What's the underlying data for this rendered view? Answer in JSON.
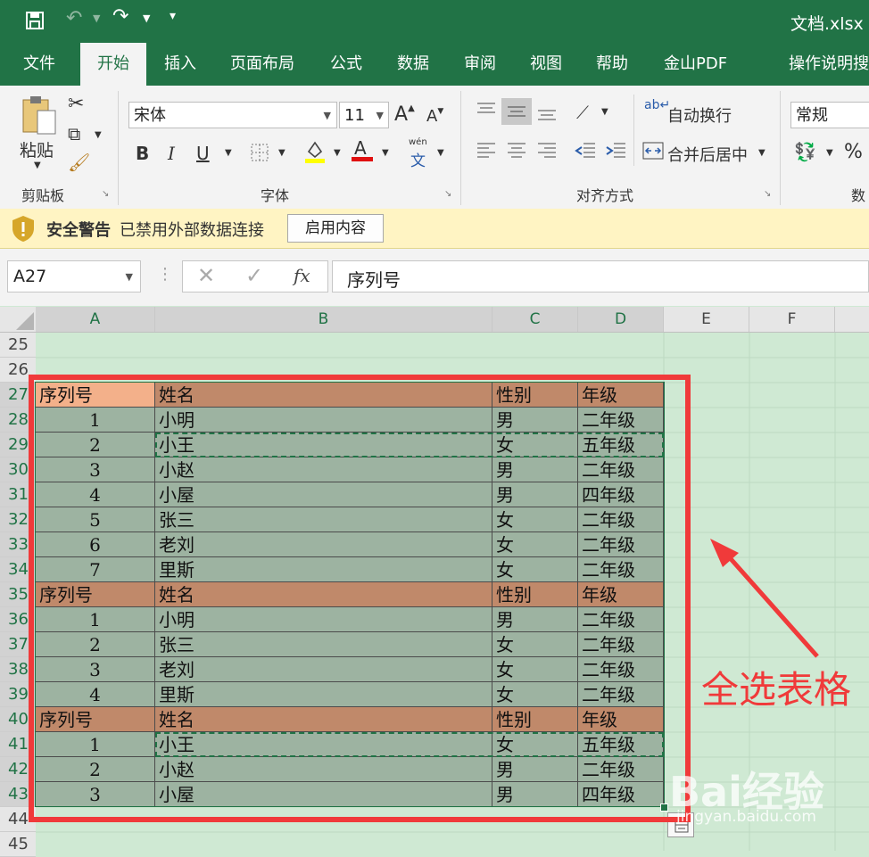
{
  "title": {
    "filename": "文档.xlsx"
  },
  "tabs": [
    "文件",
    "开始",
    "插入",
    "页面布局",
    "公式",
    "数据",
    "审阅",
    "视图",
    "帮助",
    "金山PDF",
    "操作说明搜"
  ],
  "ribbon": {
    "clipboard": {
      "paste": "粘贴",
      "label": "剪贴板"
    },
    "font": {
      "name": "宋体",
      "size": "11",
      "label": "字体",
      "bold": "B",
      "italic": "I",
      "underline": "U",
      "phonetic": "wén",
      "phonetic2": "文"
    },
    "align": {
      "wrap": "自动换行",
      "merge": "合并后居中",
      "label": "对齐方式"
    },
    "number": {
      "format": "常规",
      "label": "数",
      "percent": "%"
    }
  },
  "security": {
    "title": "安全警告",
    "message": "已禁用外部数据连接",
    "button": "启用内容"
  },
  "formula": {
    "namebox": "A27",
    "fx": "fx",
    "value": "序列号"
  },
  "columns": [
    "A",
    "B",
    "C",
    "D",
    "E",
    "F"
  ],
  "rows": [
    "25",
    "26",
    "27",
    "28",
    "29",
    "30",
    "31",
    "32",
    "33",
    "34",
    "35",
    "36",
    "37",
    "38",
    "39",
    "40",
    "41",
    "42",
    "43",
    "44",
    "45"
  ],
  "table": [
    [
      "序列号",
      "姓名",
      "性别",
      "年级"
    ],
    [
      "1",
      "小明",
      "男",
      "二年级"
    ],
    [
      "2",
      "小王",
      "女",
      "五年级"
    ],
    [
      "3",
      "小赵",
      "男",
      "二年级"
    ],
    [
      "4",
      "小屋",
      "男",
      "四年级"
    ],
    [
      "5",
      "张三",
      "女",
      "二年级"
    ],
    [
      "6",
      "老刘",
      "女",
      "二年级"
    ],
    [
      "7",
      "里斯",
      "女",
      "二年级"
    ],
    [
      "序列号",
      "姓名",
      "性别",
      "年级"
    ],
    [
      "1",
      "小明",
      "男",
      "二年级"
    ],
    [
      "2",
      "张三",
      "女",
      "二年级"
    ],
    [
      "3",
      "老刘",
      "女",
      "二年级"
    ],
    [
      "4",
      "里斯",
      "女",
      "二年级"
    ],
    [
      "序列号",
      "姓名",
      "性别",
      "年级"
    ],
    [
      "1",
      "小王",
      "女",
      "五年级"
    ],
    [
      "2",
      "小赵",
      "男",
      "二年级"
    ],
    [
      "3",
      "小屋",
      "男",
      "四年级"
    ]
  ],
  "annotation": {
    "text": "全选表格"
  },
  "watermark": {
    "text": "Bai经验",
    "sub": "jingyan.baidu.com"
  },
  "colors": {
    "accent": "#217346",
    "header": "#c0896a",
    "data": "#9db3a1",
    "annotation": "#f03a3a"
  }
}
